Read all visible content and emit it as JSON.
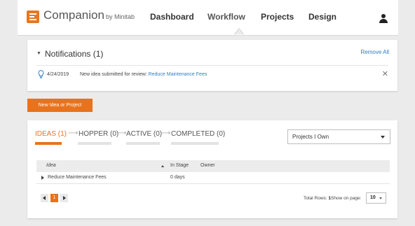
{
  "header": {
    "brand": "Companion",
    "brand_by": "by Minitab",
    "nav": {
      "dashboard": "Dashboard",
      "workflow": "Workflow",
      "projects": "Projects",
      "design": "Design"
    },
    "active_nav": "Workflow"
  },
  "notifications": {
    "title": "Notifications (1)",
    "remove_all": "Remove All",
    "items": [
      {
        "date": "4/24/2019",
        "text": "New idea submitted for review:",
        "link": "Reduce Maintenance Fees"
      }
    ]
  },
  "new_button": "New Idea or Project",
  "stages": [
    {
      "label": "IDEAS (1)",
      "active": true
    },
    {
      "label": "HOPPER (0)",
      "active": false
    },
    {
      "label": "ACTIVE (0)",
      "active": false
    },
    {
      "label": "COMPLETED (0)",
      "active": false
    }
  ],
  "filter": {
    "selected": "Projects I Own"
  },
  "table": {
    "columns": [
      "Idea",
      "In Stage",
      "Owner"
    ],
    "sort_column": "Idea",
    "rows": [
      {
        "idea": "Reduce Maintenance Fees",
        "in_stage": "0 days",
        "owner": ""
      }
    ]
  },
  "pagination": {
    "current_page": "1",
    "total_rows_label": "Total Rows:",
    "total_rows": "1",
    "show_on_page_label": "Show on page:",
    "page_size": "10"
  },
  "colors": {
    "accent": "#e8731c",
    "link": "#2f7cc4",
    "background": "#ebebeb"
  }
}
